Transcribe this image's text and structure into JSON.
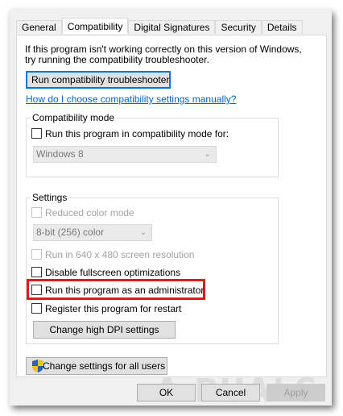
{
  "tabs": [
    "General",
    "Compatibility",
    "Digital Signatures",
    "Security",
    "Details"
  ],
  "intro": {
    "line1": "If this program isn't working correctly on this version of Windows,",
    "line2": "try running the compatibility troubleshooter."
  },
  "troubleshooter_button": "Run compatibility troubleshooter",
  "manual_link": "How do I choose compatibility settings manually?",
  "compat_mode": {
    "legend": "Compatibility mode",
    "checkbox_label": "Run this program in compatibility mode for:",
    "os_value": "Windows 8"
  },
  "settings": {
    "legend": "Settings",
    "reduced_color_label": "Reduced color mode",
    "color_value": "8-bit (256) color",
    "res_label": "Run in 640 x 480 screen resolution",
    "fullscreen_label": "Disable fullscreen optimizations",
    "admin_label": "Run this program as an administrator",
    "restart_label": "Register this program for restart",
    "dpi_button": "Change high DPI settings"
  },
  "all_users_button": "Change settings for all users",
  "footer": {
    "ok": "OK",
    "cancel": "Cancel",
    "apply": "Apply"
  },
  "watermark": "A PUALS",
  "colors": {
    "highlight": "#e01b1b",
    "link": "#0066cc",
    "focus": "#0078d7"
  }
}
